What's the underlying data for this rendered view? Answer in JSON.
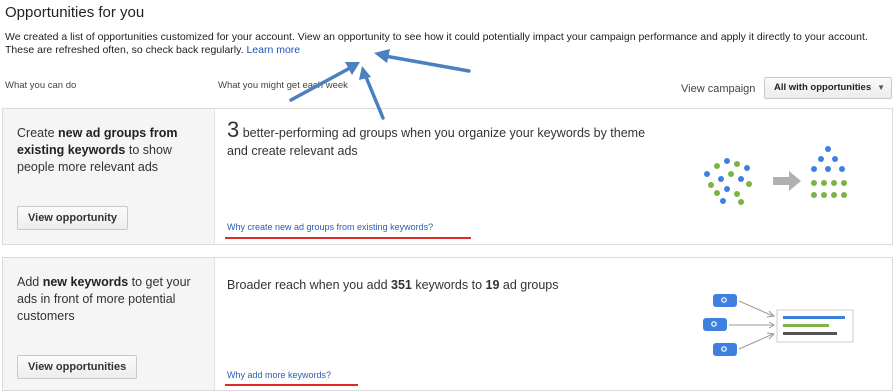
{
  "title": "Opportunities for you",
  "intro": {
    "text": "We created a list of opportunities customized for your account. View an opportunity to see how it could potentially impact your campaign performance and apply it directly to your account. These are refreshed often, so check back regularly.",
    "learn_more": "Learn more"
  },
  "columns": {
    "what_you_can_do": "What you can do",
    "what_you_might_get": "What you might get each week"
  },
  "view_campaign": {
    "label": "View campaign",
    "selected": "All with opportunities"
  },
  "cards": [
    {
      "desc_pre": "Create ",
      "desc_bold": "new ad groups from existing keywords",
      "desc_post": " to show people more relevant ads",
      "button": "View opportunity",
      "headline_number": "3",
      "headline_text": "better-performing ad groups when you organize your keywords by theme and create relevant ads",
      "why_link": "Why create new ad groups from existing keywords?"
    },
    {
      "desc_pre": "Add ",
      "desc_bold": "new keywords",
      "desc_post": " to get your ads in front of more potential customers",
      "button": "View opportunities",
      "headline_pre": "Broader reach when you add ",
      "keywords_count": "351",
      "headline_mid": " keywords to ",
      "adgroups_count": "19",
      "headline_post": " ad groups",
      "why_link": "Why add more keywords?"
    }
  ],
  "colors": {
    "accent_blue": "#3d80e0",
    "accent_green": "#7cb342",
    "annotation_red": "#e02a2a",
    "link_blue": "#1a55b5"
  }
}
